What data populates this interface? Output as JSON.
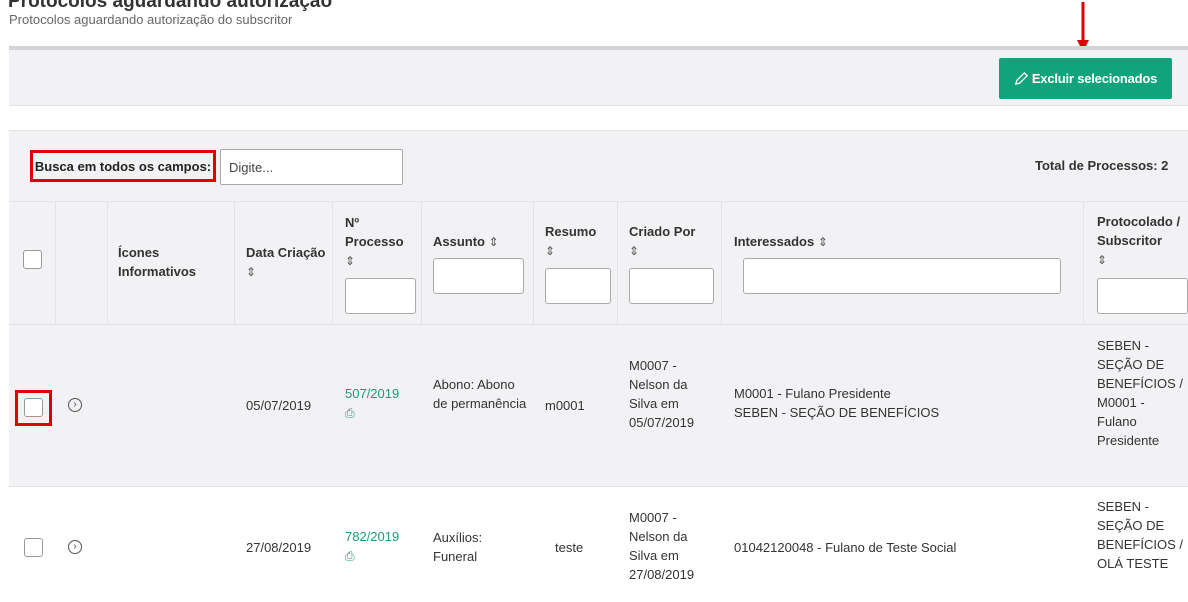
{
  "page": {
    "title": "Protocolos aguardando autorização",
    "subtitle": "Protocolos aguardando autorização do subscritor"
  },
  "toolbar": {
    "delete_label": "Excluir selecionados",
    "delete_icon": "pencil-icon",
    "accent": "#11a37c"
  },
  "search": {
    "label": "Busca em todos os campos:",
    "placeholder": "Digite...",
    "value": "",
    "total_label": "Total de Processos: 2"
  },
  "table": {
    "headers": {
      "icons": "Ícones Informativos",
      "date": "Data Criação",
      "process": "Nº Processo",
      "subject": "Assunto",
      "summary": "Resumo",
      "created_by": "Criado Por",
      "interested": "Interessados",
      "protocoled": "Protocolado / Subscritor"
    },
    "sort_icon": "⇕",
    "rows": [
      {
        "date": "05/07/2019",
        "process": "507/2019",
        "subject": "Abono: Abono de permanência",
        "summary": "m0001",
        "created_by": "M0007 - Nelson da Silva em 05/07/2019",
        "interested_1": "M0001 - Fulano Presidente",
        "interested_2": "SEBEN - SEÇÃO DE BENEFÍCIOS",
        "protocoled": "SEBEN - SEÇÃO DE BENEFÍCIOS / M0001 - Fulano Presidente"
      },
      {
        "date": "27/08/2019",
        "process": "782/2019",
        "subject": "Auxílios: Funeral",
        "summary": "teste",
        "created_by": "M0007 - Nelson da Silva em 27/08/2019",
        "interested_1": "01042120048 - Fulano de Teste Social",
        "interested_2": "",
        "protocoled": "SEBEN - SEÇÃO DE BENEFÍCIOS / OLÁ TESTE"
      }
    ]
  },
  "colors": {
    "highlight": "#e00000",
    "link": "#1f9a77",
    "header_bg": "#f2f2f4"
  }
}
